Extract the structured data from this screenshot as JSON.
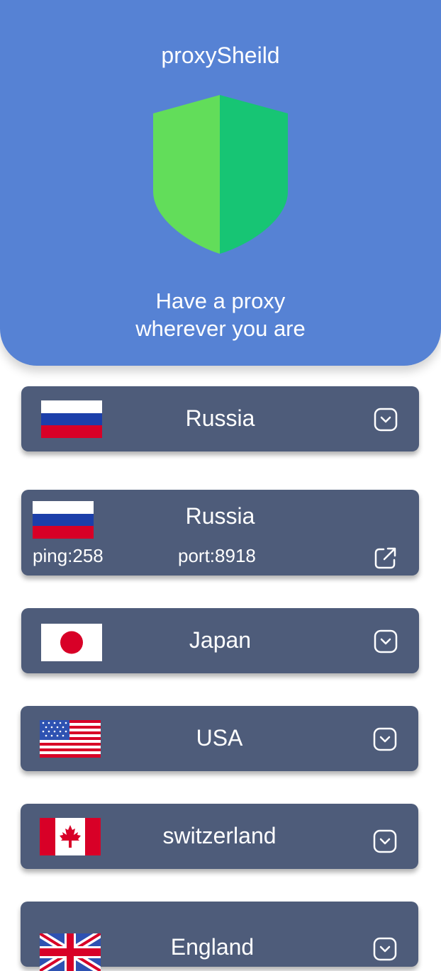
{
  "app": {
    "title": "proxySheild",
    "tagline_line1": "Have a proxy",
    "tagline_line2": "wherever you are"
  },
  "colors": {
    "header_bg": "#5682D4",
    "card_bg": "#4E5C7A",
    "shield_left": "#62DD5A",
    "shield_right": "#17C574"
  },
  "servers": [
    {
      "country": "Russia",
      "flag": "russia-flag",
      "expanded": false
    },
    {
      "country": "Russia",
      "flag": "russia-flag",
      "expanded": true,
      "ping": "ping:258",
      "port": "port:8918"
    },
    {
      "country": "Japan",
      "flag": "japan-flag",
      "expanded": false
    },
    {
      "country": "USA",
      "flag": "usa-flag",
      "expanded": false
    },
    {
      "country": "switzerland",
      "flag": "canada-flag",
      "expanded": false
    },
    {
      "country": "England",
      "flag": "uk-flag",
      "expanded": false
    }
  ]
}
